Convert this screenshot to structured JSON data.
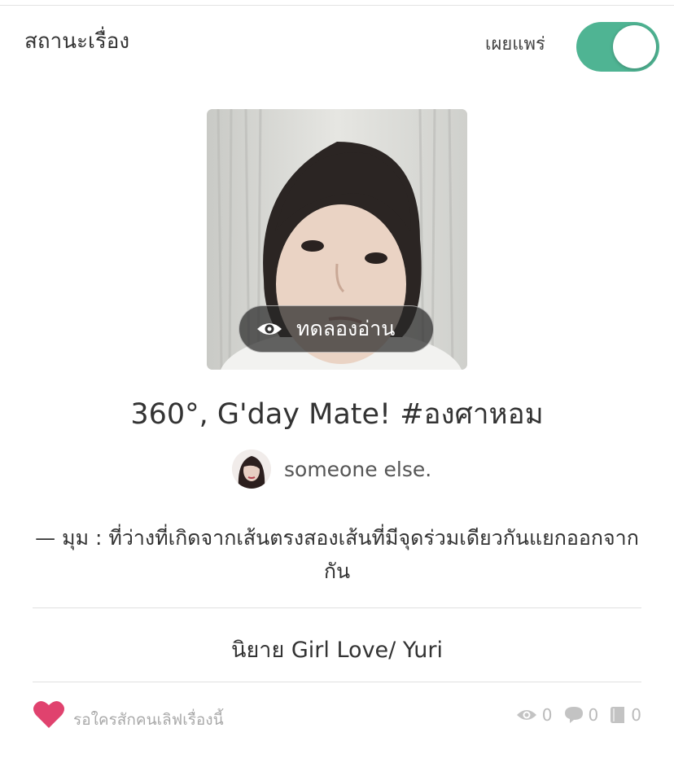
{
  "header": {
    "status_label": "สถานะเรื่อง",
    "publish_label": "เผยแพร่",
    "published": true,
    "toggle_color": "#4fb493"
  },
  "cover": {
    "preview_label": "ทดลองอ่าน",
    "preview_icon": "eye-icon"
  },
  "story": {
    "title": "360°, G'day Mate! #องศาหอม",
    "author": "someone else.",
    "tagline": "— มุม : ที่ว่างที่เกิดจากเส้นตรงสองเส้นที่มีจุดร่วมเดียวกันแยกออกจากกัน",
    "category": "นิยาย Girl Love/ Yuri"
  },
  "footer": {
    "love_text": "รอใครสักคนเลิฟเรื่องนี้",
    "heart_color": "#e0426e",
    "views": "0",
    "comments": "0",
    "chapters": "0"
  }
}
